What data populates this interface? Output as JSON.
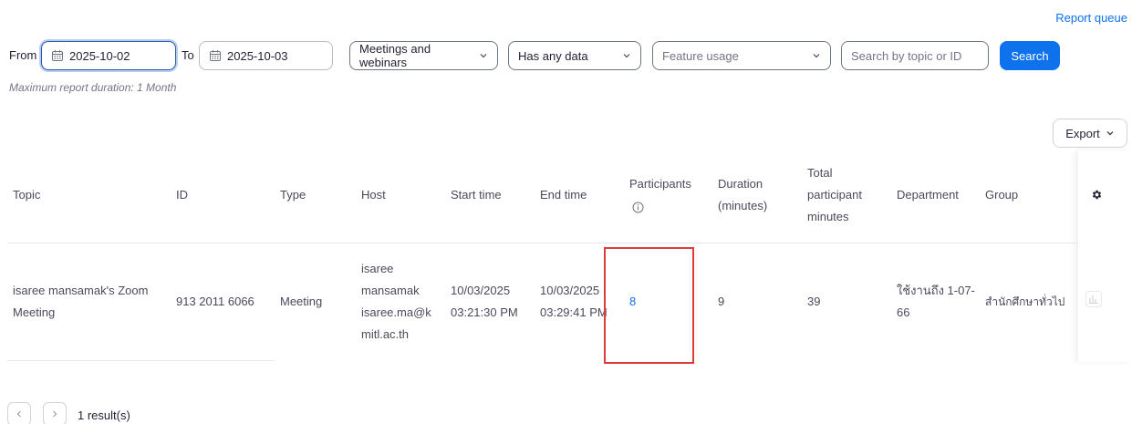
{
  "header": {
    "report_queue": "Report queue"
  },
  "filters": {
    "from_label": "From",
    "from_date": "2025-10-02",
    "to_label": "To",
    "to_date": "2025-10-03",
    "meeting_type": "Meetings and webinars",
    "data_filter": "Has any data",
    "feature_usage_placeholder": "Feature usage",
    "search_placeholder": "Search by topic or ID",
    "search_button": "Search",
    "hint": "Maximum report duration: 1 Month"
  },
  "toolbar": {
    "export_label": "Export"
  },
  "table": {
    "headers": {
      "topic": "Topic",
      "id": "ID",
      "type": "Type",
      "host": "Host",
      "start_time": "Start time",
      "end_time": "End time",
      "participants": "Participants",
      "duration": [
        "Duration",
        "(minutes)"
      ],
      "total_minutes": [
        "Total",
        "participant",
        "minutes"
      ],
      "department": "Department",
      "group": "Group"
    },
    "rows": [
      {
        "topic": [
          "isaree mansamak's Zoom",
          "Meeting"
        ],
        "id": "913 2011 6066",
        "type": "Meeting",
        "host": [
          "isaree",
          "mansamak",
          "isaree.ma@k",
          "mitl.ac.th"
        ],
        "start_time": [
          "10/03/2025",
          "03:21:30 PM"
        ],
        "end_time": [
          "10/03/2025",
          "03:29:41 PM"
        ],
        "participants": "8",
        "duration": "9",
        "total_minutes": "39",
        "department": [
          "ใช้งานถึง 1-07-",
          "66"
        ],
        "group": "สำนักศึกษาทั่วไป"
      }
    ]
  },
  "pagination": {
    "results": "1 result(s)"
  },
  "colors": {
    "accent": "#0e72ed",
    "highlight": "#e03b3b"
  }
}
